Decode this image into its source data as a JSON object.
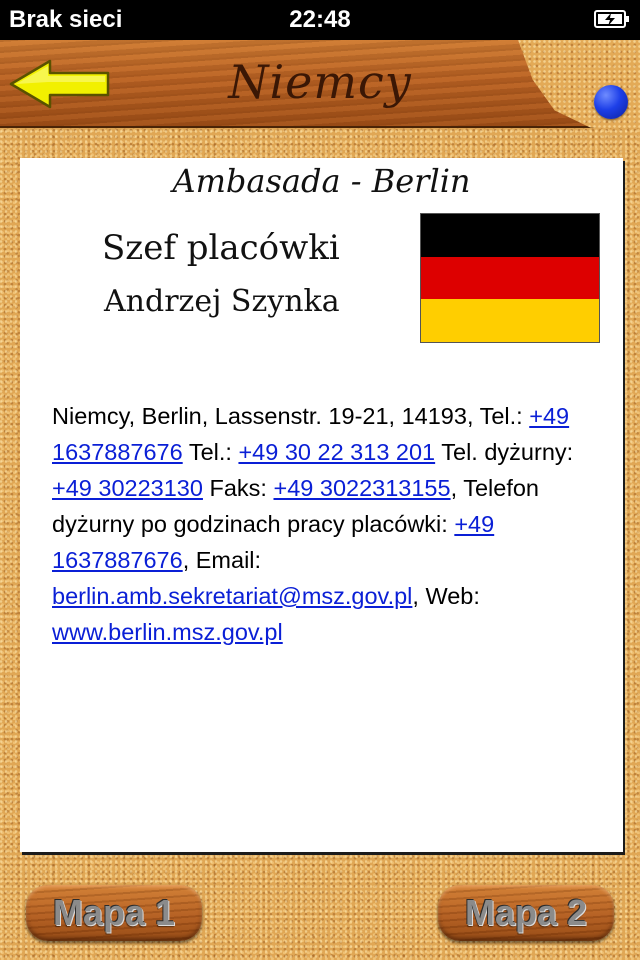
{
  "status_bar": {
    "carrier": "Brak sieci",
    "time": "22:48",
    "battery_icon": "battery-charging-icon"
  },
  "header": {
    "title": "Niemcy",
    "back_icon": "arrow-left-icon"
  },
  "card": {
    "title": "Ambasada - Berlin",
    "head_label": "Szef placówki",
    "head_name": "Andrzej Szynka",
    "flag": {
      "colors": [
        "#000000",
        "#dd0000",
        "#ffce00"
      ]
    }
  },
  "contact": {
    "address": "Niemcy, Berlin, Lassenstr. 19-21, 14193,",
    "tel_label_1": "Tel.:",
    "tel_1": "+49 1637887676",
    "tel_label_2": "Tel.:",
    "tel_2": "+49 30 22 313 201",
    "duty_label": "Tel. dyżurny:",
    "duty_phone": "+49 30223130",
    "fax_label": "Faks:",
    "fax": "+49 3022313155",
    "after_hours_label": ", Telefon dyżurny po godzinach pracy placówki:",
    "after_hours_phone": "+49 1637887676",
    "email_label": ", Email:",
    "email": "berlin.amb.sekretariat@msz.gov.pl",
    "web_label": ", Web:",
    "web": "www.berlin.msz.gov.pl"
  },
  "buttons": {
    "map1": "Mapa 1",
    "map2": "Mapa 2"
  },
  "colors": {
    "wood": "#b96224",
    "cork": "#e0a755",
    "link": "#0a1fd6",
    "blue_dot": "#1d3fe8"
  }
}
